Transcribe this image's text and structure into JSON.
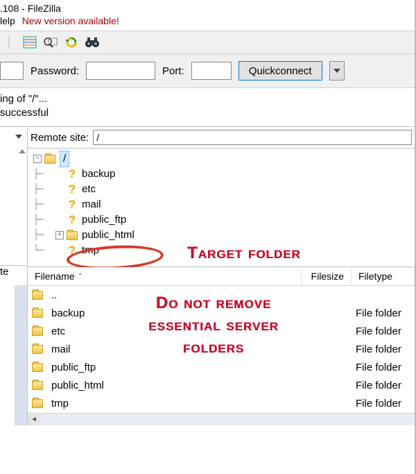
{
  "title_suffix": ".108 - FileZilla",
  "menu": {
    "help": "lelp",
    "new_version": "New version available!"
  },
  "quickconnect": {
    "host_value": "",
    "password_label": "Password:",
    "password_value": "",
    "port_label": "Port:",
    "port_value": "",
    "button": "Quickconnect"
  },
  "log": {
    "line1": "ing of  \"/\"...",
    "line2": "successful"
  },
  "left": {
    "te_label": "te"
  },
  "remote": {
    "label": "Remote site:",
    "path": "/",
    "tree": {
      "root": "/",
      "items": [
        {
          "name": "backup",
          "icon": "question"
        },
        {
          "name": "etc",
          "icon": "question"
        },
        {
          "name": "mail",
          "icon": "question"
        },
        {
          "name": "public_ftp",
          "icon": "question"
        },
        {
          "name": "public_html",
          "icon": "folder",
          "expandable": true
        },
        {
          "name": "tmp",
          "icon": "question"
        }
      ]
    }
  },
  "annotations": {
    "target": "Target folder",
    "warn": "Do not remove essential server folders"
  },
  "filelist": {
    "columns": {
      "name": "Filename",
      "size": "Filesize",
      "type": "Filetype"
    },
    "rows": [
      {
        "name": "..",
        "type": ""
      },
      {
        "name": "backup",
        "type": "File folder"
      },
      {
        "name": "etc",
        "type": "File folder"
      },
      {
        "name": "mail",
        "type": "File folder"
      },
      {
        "name": "public_ftp",
        "type": "File folder"
      },
      {
        "name": "public_html",
        "type": "File folder"
      },
      {
        "name": "tmp",
        "type": "File folder"
      }
    ]
  }
}
